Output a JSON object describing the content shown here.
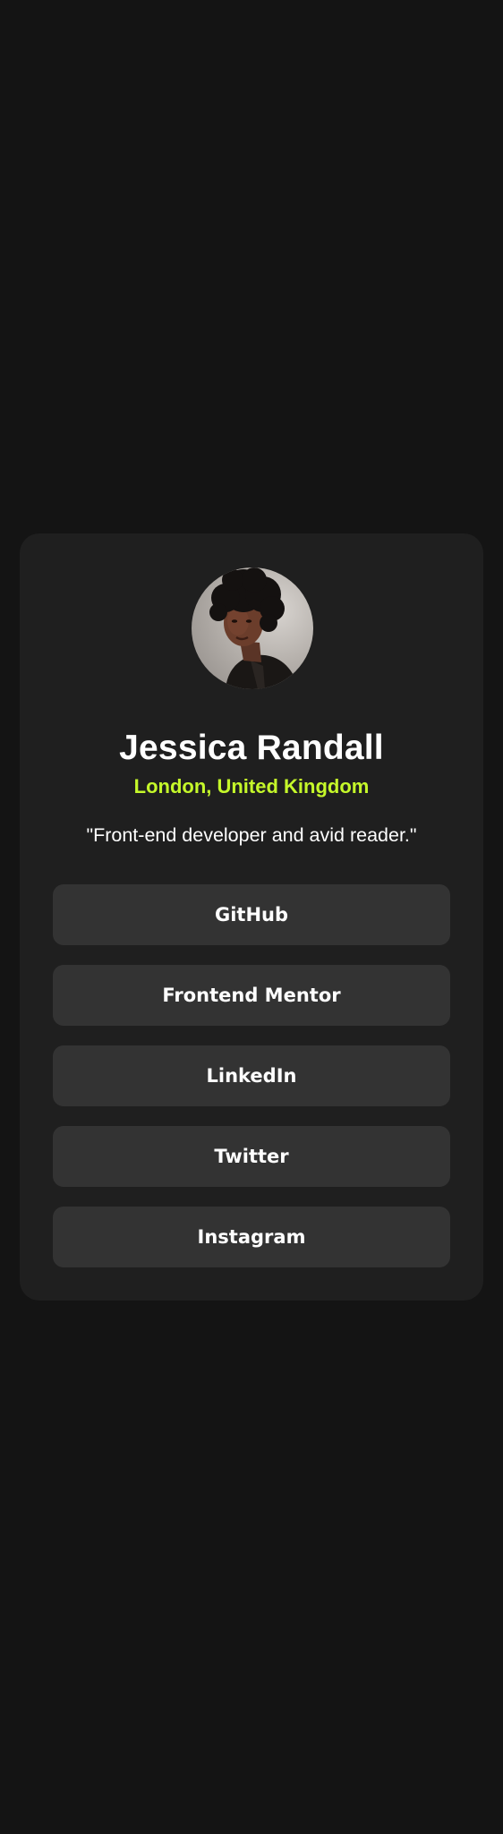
{
  "profile": {
    "name": "Jessica Randall",
    "location": "London, United Kingdom",
    "bio": "\"Front-end developer and avid reader.\""
  },
  "links": [
    {
      "label": "GitHub"
    },
    {
      "label": "Frontend Mentor"
    },
    {
      "label": "LinkedIn"
    },
    {
      "label": "Twitter"
    },
    {
      "label": "Instagram"
    }
  ],
  "colors": {
    "page_background": "#141414",
    "card_background": "#1f1f1f",
    "button_background": "#333333",
    "accent": "#c5f82a",
    "text": "#ffffff"
  }
}
